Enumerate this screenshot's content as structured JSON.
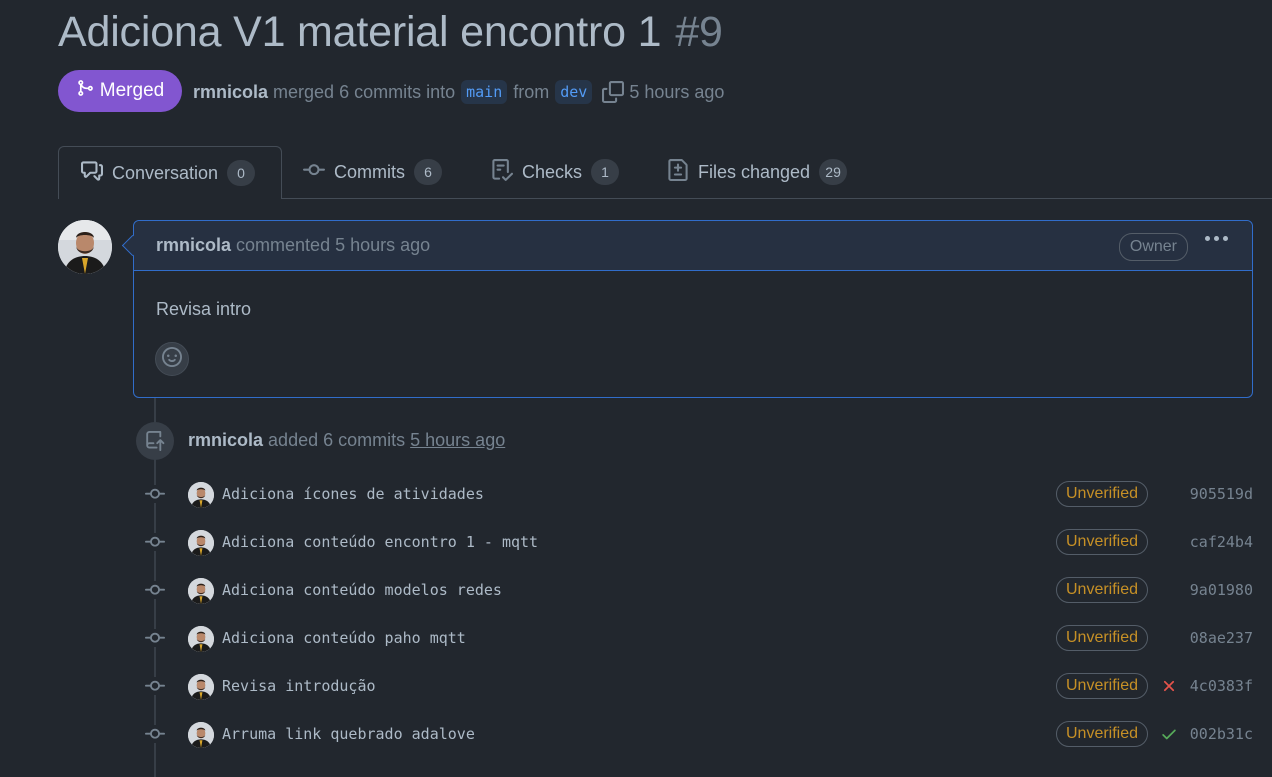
{
  "pr": {
    "title": "Adiciona V1 material encontro 1",
    "number": "#9",
    "state_label": "Merged",
    "author": "rmnicola",
    "merged_text": "merged 6 commits into",
    "base_branch": "main",
    "from_text": "from",
    "head_branch": "dev",
    "time": "5 hours ago"
  },
  "tabs": [
    {
      "label": "Conversation",
      "count": "0",
      "active": true,
      "icon": "comment-discussion-icon"
    },
    {
      "label": "Commits",
      "count": "6",
      "icon": "git-commit-icon"
    },
    {
      "label": "Checks",
      "count": "1",
      "icon": "checklist-icon"
    },
    {
      "label": "Files changed",
      "count": "29",
      "icon": "file-diff-icon"
    }
  ],
  "comment": {
    "author": "rmnicola",
    "action": "commented 5 hours ago",
    "role_badge": "Owner",
    "body": "Revisa intro"
  },
  "event": {
    "author": "rmnicola",
    "action": "added 6 commits",
    "time": "5 hours ago"
  },
  "commits": [
    {
      "message": "Adiciona ícones de atividades",
      "badge": "Unverified",
      "status": "",
      "sha": "905519d"
    },
    {
      "message": "Adiciona conteúdo encontro 1 - mqtt",
      "badge": "Unverified",
      "status": "",
      "sha": "caf24b4"
    },
    {
      "message": "Adiciona conteúdo modelos redes",
      "badge": "Unverified",
      "status": "",
      "sha": "9a01980"
    },
    {
      "message": "Adiciona conteúdo paho mqtt",
      "badge": "Unverified",
      "status": "",
      "sha": "08ae237"
    },
    {
      "message": "Revisa introdução",
      "badge": "Unverified",
      "status": "failure",
      "sha": "4c0383f"
    },
    {
      "message": "Arruma link quebrado adalove",
      "badge": "Unverified",
      "status": "success",
      "sha": "002b31c"
    }
  ],
  "colors": {
    "background": "#22272e",
    "merged": "#8256d0",
    "accent": "#316dca",
    "unverified": "#c69026",
    "success": "#57ab5a",
    "failure": "#e5534b"
  }
}
